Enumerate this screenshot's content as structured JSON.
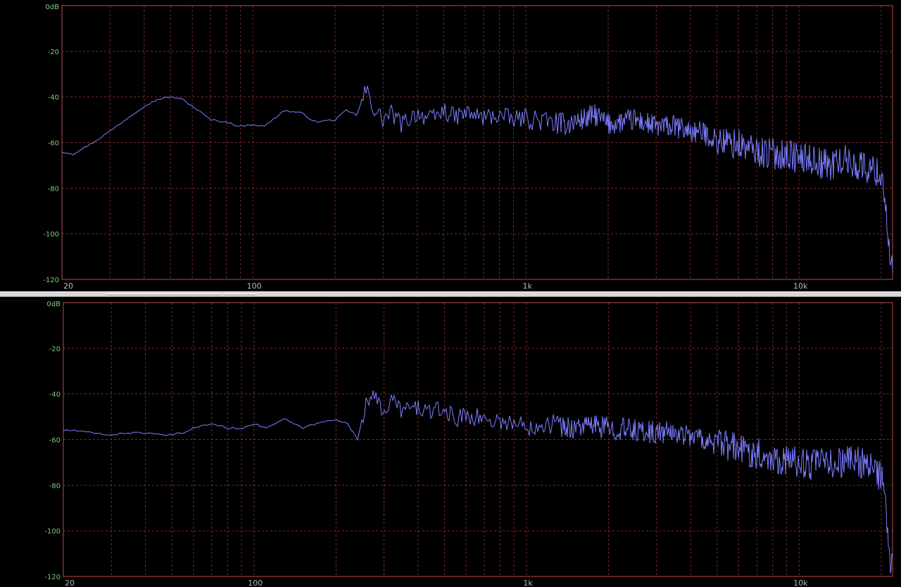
{
  "chart_data": [
    {
      "type": "line",
      "title": "",
      "xscale": "log",
      "xlim": [
        20,
        22000
      ],
      "ylim": [
        -120,
        0
      ],
      "grid": true,
      "x_ticks": [
        20,
        100,
        "1k",
        "10k"
      ],
      "y_ticks": [
        "0dB",
        "-20",
        "-40",
        "-60",
        "-80",
        "-100",
        "-120"
      ],
      "line_color": "#7d7dff",
      "series": [
        {
          "x": [
            20,
            22,
            26,
            30,
            35,
            40,
            45,
            50,
            55,
            60,
            70,
            80,
            90,
            100,
            110,
            130,
            150,
            170,
            200,
            220,
            240,
            260,
            280,
            300,
            320,
            350,
            400,
            450,
            500,
            550,
            600,
            650,
            700,
            800,
            900,
            1000,
            1200,
            1400,
            1600,
            1800,
            2000,
            2500,
            3000,
            3500,
            4000,
            4500,
            5000,
            6000,
            7000,
            8000,
            9000,
            10000,
            11000,
            12000,
            13000,
            14000,
            15000,
            16000,
            17000,
            18000,
            19000,
            20000,
            20500,
            21000,
            21500,
            22000
          ],
          "y": [
            -64,
            -65,
            -60,
            -55,
            -49,
            -44,
            -41,
            -40,
            -41,
            -44,
            -50,
            -51,
            -53,
            -52,
            -53,
            -46,
            -47,
            -51,
            -50,
            -46,
            -48,
            -37,
            -46,
            -50,
            -47,
            -52,
            -47,
            -50,
            -46,
            -49,
            -47,
            -48,
            -49,
            -48,
            -50,
            -49,
            -51,
            -52,
            -50,
            -48,
            -52,
            -50,
            -53,
            -53,
            -55,
            -56,
            -59,
            -61,
            -64,
            -65,
            -65,
            -67,
            -67,
            -69,
            -70,
            -68,
            -68,
            -70,
            -70,
            -72,
            -72,
            -75,
            -80,
            -95,
            -112,
            -118
          ]
        }
      ]
    },
    {
      "type": "line",
      "title": "",
      "xscale": "log",
      "xlim": [
        20,
        22000
      ],
      "ylim": [
        -120,
        0
      ],
      "grid": true,
      "x_ticks": [
        20,
        100,
        "1k",
        "10k"
      ],
      "y_ticks": [
        "0dB",
        "-20",
        "-40",
        "-60",
        "-80",
        "-100",
        "-120"
      ],
      "line_color": "#7d7dff",
      "series": [
        {
          "x": [
            20,
            22,
            25,
            30,
            35,
            40,
            45,
            50,
            55,
            60,
            70,
            80,
            90,
            100,
            110,
            130,
            150,
            170,
            200,
            220,
            240,
            260,
            280,
            300,
            320,
            350,
            400,
            450,
            500,
            550,
            600,
            650,
            700,
            800,
            900,
            1000,
            1200,
            1400,
            1600,
            1800,
            2000,
            2500,
            3000,
            3500,
            4000,
            4500,
            5000,
            6000,
            7000,
            8000,
            9000,
            10000,
            11000,
            12000,
            13000,
            14000,
            15000,
            16000,
            17000,
            18000,
            19000,
            20000,
            20500,
            21000,
            21500,
            22000
          ],
          "y": [
            -56,
            -56,
            -57,
            -58,
            -57,
            -57,
            -58,
            -58,
            -57,
            -55,
            -53,
            -55,
            -55,
            -53,
            -55,
            -51,
            -55,
            -53,
            -51,
            -53,
            -60,
            -41,
            -43,
            -47,
            -43,
            -47,
            -46,
            -48,
            -47,
            -51,
            -49,
            -50,
            -51,
            -52,
            -53,
            -54,
            -52,
            -55,
            -54,
            -54,
            -55,
            -56,
            -57,
            -57,
            -58,
            -60,
            -62,
            -64,
            -66,
            -68,
            -69,
            -70,
            -71,
            -70,
            -71,
            -70,
            -69,
            -69,
            -70,
            -72,
            -74,
            -77,
            -82,
            -100,
            -113,
            -118
          ]
        }
      ]
    }
  ]
}
